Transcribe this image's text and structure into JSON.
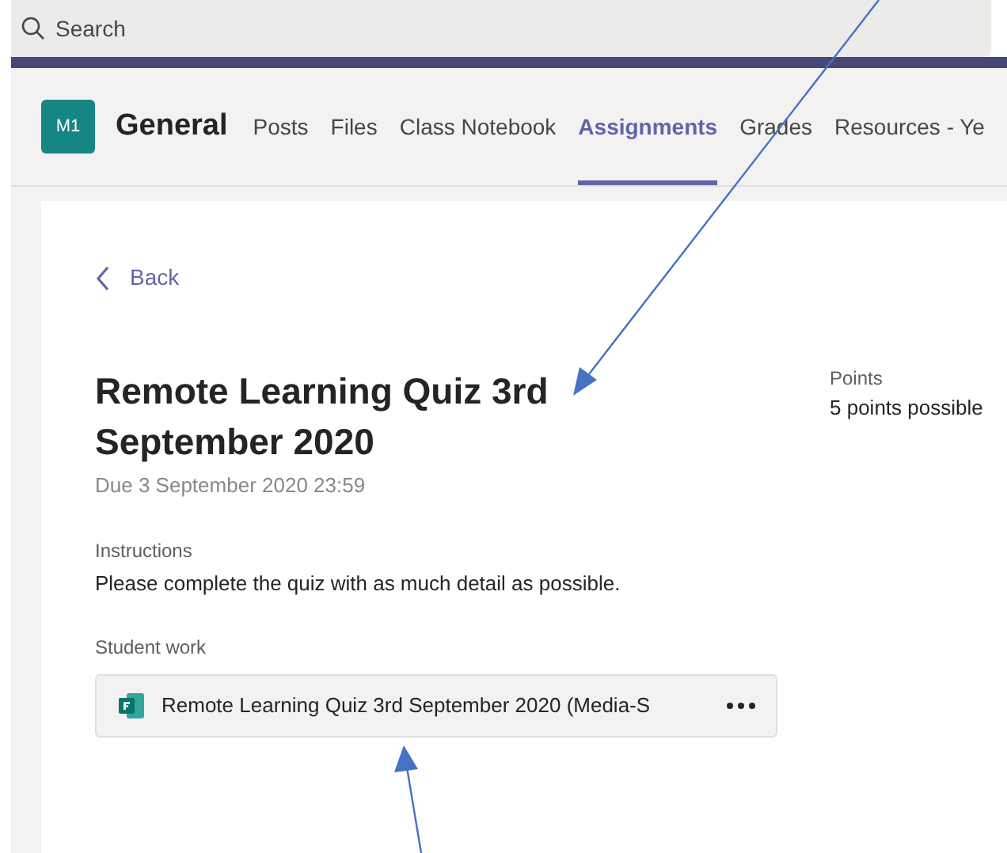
{
  "search": {
    "placeholder": "Search"
  },
  "channel": {
    "avatar": "M1",
    "name": "General"
  },
  "tabs": [
    {
      "label": "Posts",
      "selected": false
    },
    {
      "label": "Files",
      "selected": false
    },
    {
      "label": "Class Notebook",
      "selected": false
    },
    {
      "label": "Assignments",
      "selected": true
    },
    {
      "label": "Grades",
      "selected": false
    },
    {
      "label": "Resources - Ye",
      "selected": false
    }
  ],
  "back": "Back",
  "assignment": {
    "title": "Remote Learning Quiz 3rd September 2020",
    "due": "Due 3 September 2020 23:59",
    "instructions_label": "Instructions",
    "instructions": "Please complete the quiz with as much detail as possible.",
    "student_work_label": "Student work",
    "attachment": "Remote Learning Quiz 3rd September 2020 (Media-S"
  },
  "points": {
    "label": "Points",
    "value": "5 points possible"
  }
}
